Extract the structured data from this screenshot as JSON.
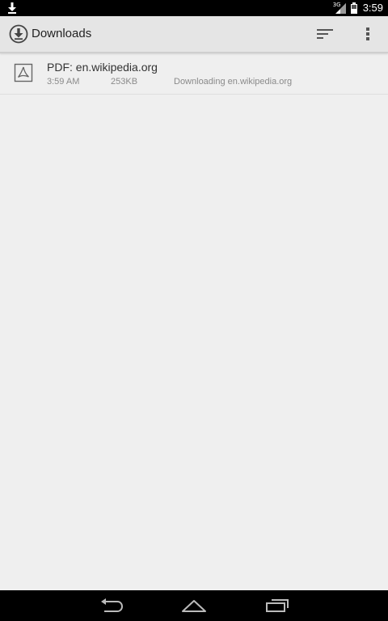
{
  "status_bar": {
    "notification_icon": "download-arrow-icon",
    "network_label": "3G",
    "signal_icon": "signal-icon",
    "battery_icon": "battery-icon",
    "time": "3:59"
  },
  "action_bar": {
    "app_icon": "download-circle-icon",
    "title": "Downloads",
    "sort_icon": "sort-icon",
    "overflow_icon": "overflow-menu-icon"
  },
  "downloads": [
    {
      "icon": "pdf-file-icon",
      "title": "PDF: en.wikipedia.org",
      "time": "3:59 AM",
      "size": "253KB",
      "status": "Downloading en.wikipedia.org"
    }
  ],
  "nav_bar": {
    "back_icon": "back-icon",
    "home_icon": "home-icon",
    "recents_icon": "recents-icon"
  },
  "colors": {
    "background": "#efefef",
    "action_bar": "#e5e5e5",
    "status_bar": "#000000",
    "nav_bar": "#000000",
    "title_text": "#222222",
    "secondary_text": "#8a8a8a"
  }
}
